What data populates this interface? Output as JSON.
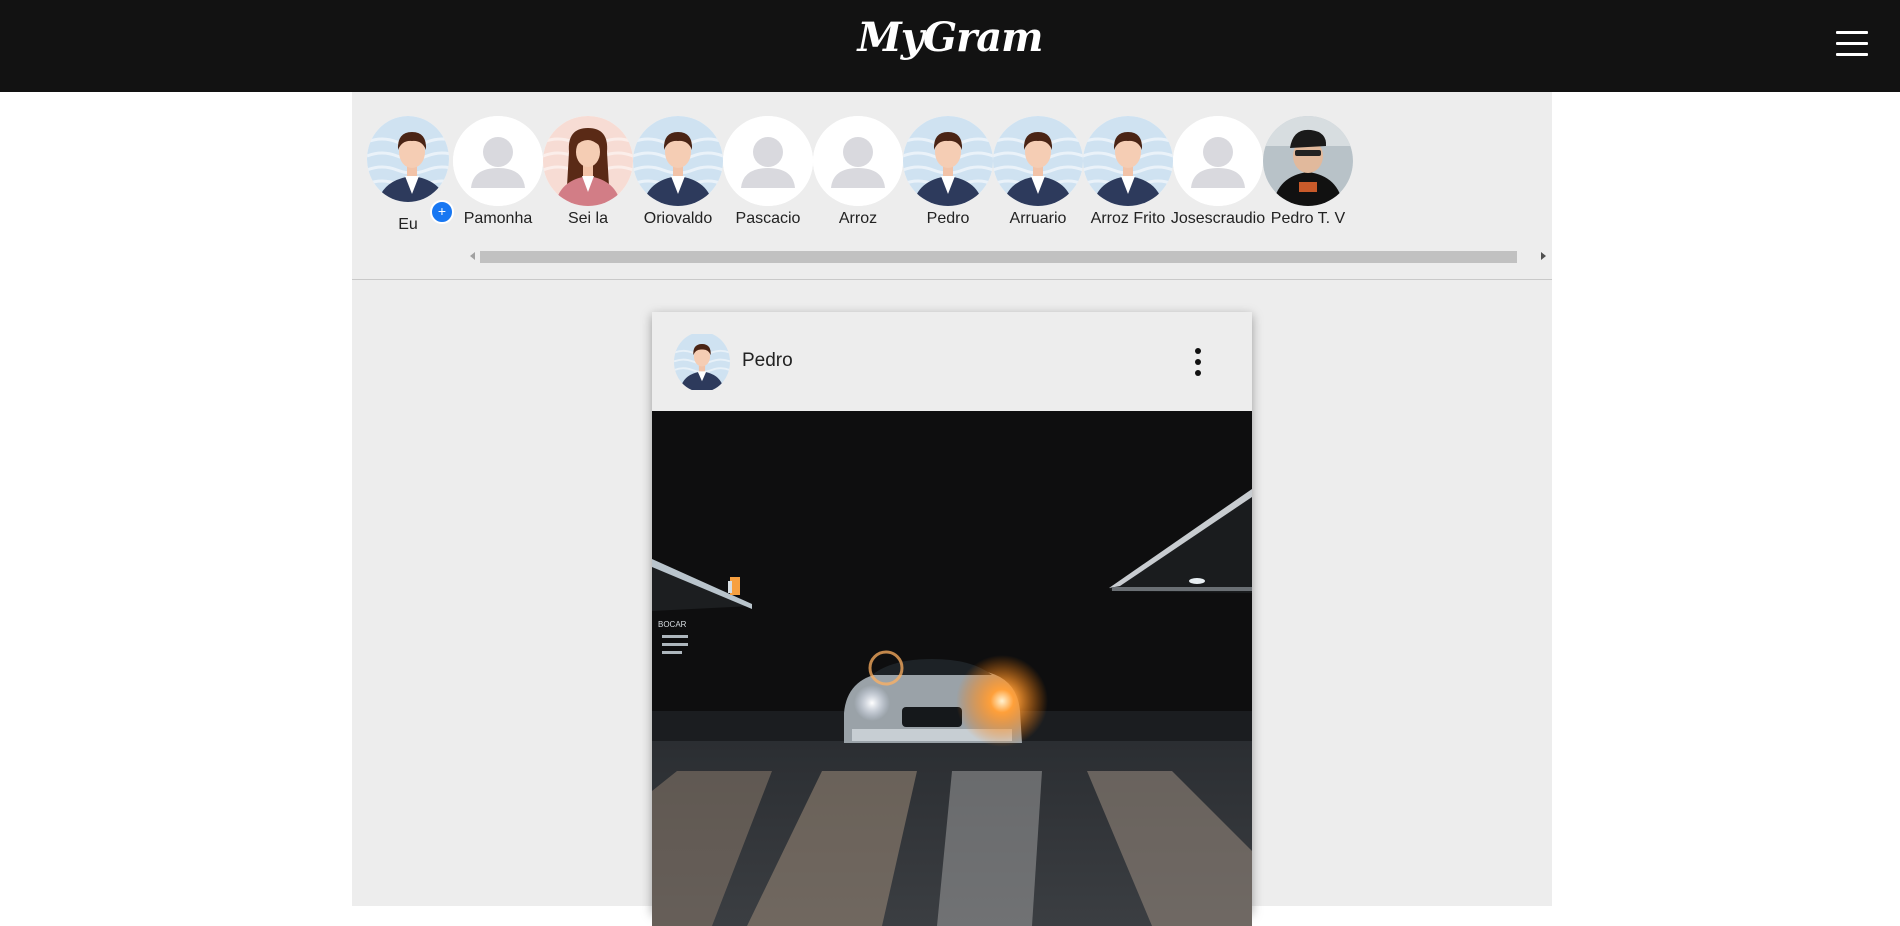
{
  "header": {
    "logo": "MyGram",
    "menu_icon": "hamburger-menu-icon"
  },
  "stories": [
    {
      "name": "Eu",
      "avatar": "male-avatar",
      "is_me": true,
      "badge": "+"
    },
    {
      "name": "Pamonha",
      "avatar": "default-user"
    },
    {
      "name": "Sei la",
      "avatar": "female-avatar"
    },
    {
      "name": "Oriovaldo",
      "avatar": "male-avatar"
    },
    {
      "name": "Pascacio",
      "avatar": "default-user"
    },
    {
      "name": "Arroz",
      "avatar": "default-user"
    },
    {
      "name": "Pedro",
      "avatar": "male-avatar"
    },
    {
      "name": "Arruario",
      "avatar": "male-avatar"
    },
    {
      "name": "Arroz Frito",
      "avatar": "male-avatar"
    },
    {
      "name": "Josescraudio",
      "avatar": "default-user"
    },
    {
      "name": "Pedro T. V",
      "avatar": "photo-avatar"
    }
  ],
  "post": {
    "username": "Pedro",
    "avatar": "male-avatar",
    "options_icon": "vertical-dots-icon",
    "image": "night-car-photo"
  },
  "colors": {
    "header_bg": "#121212",
    "page_bg": "#ededed",
    "badge": "#1877f2"
  }
}
